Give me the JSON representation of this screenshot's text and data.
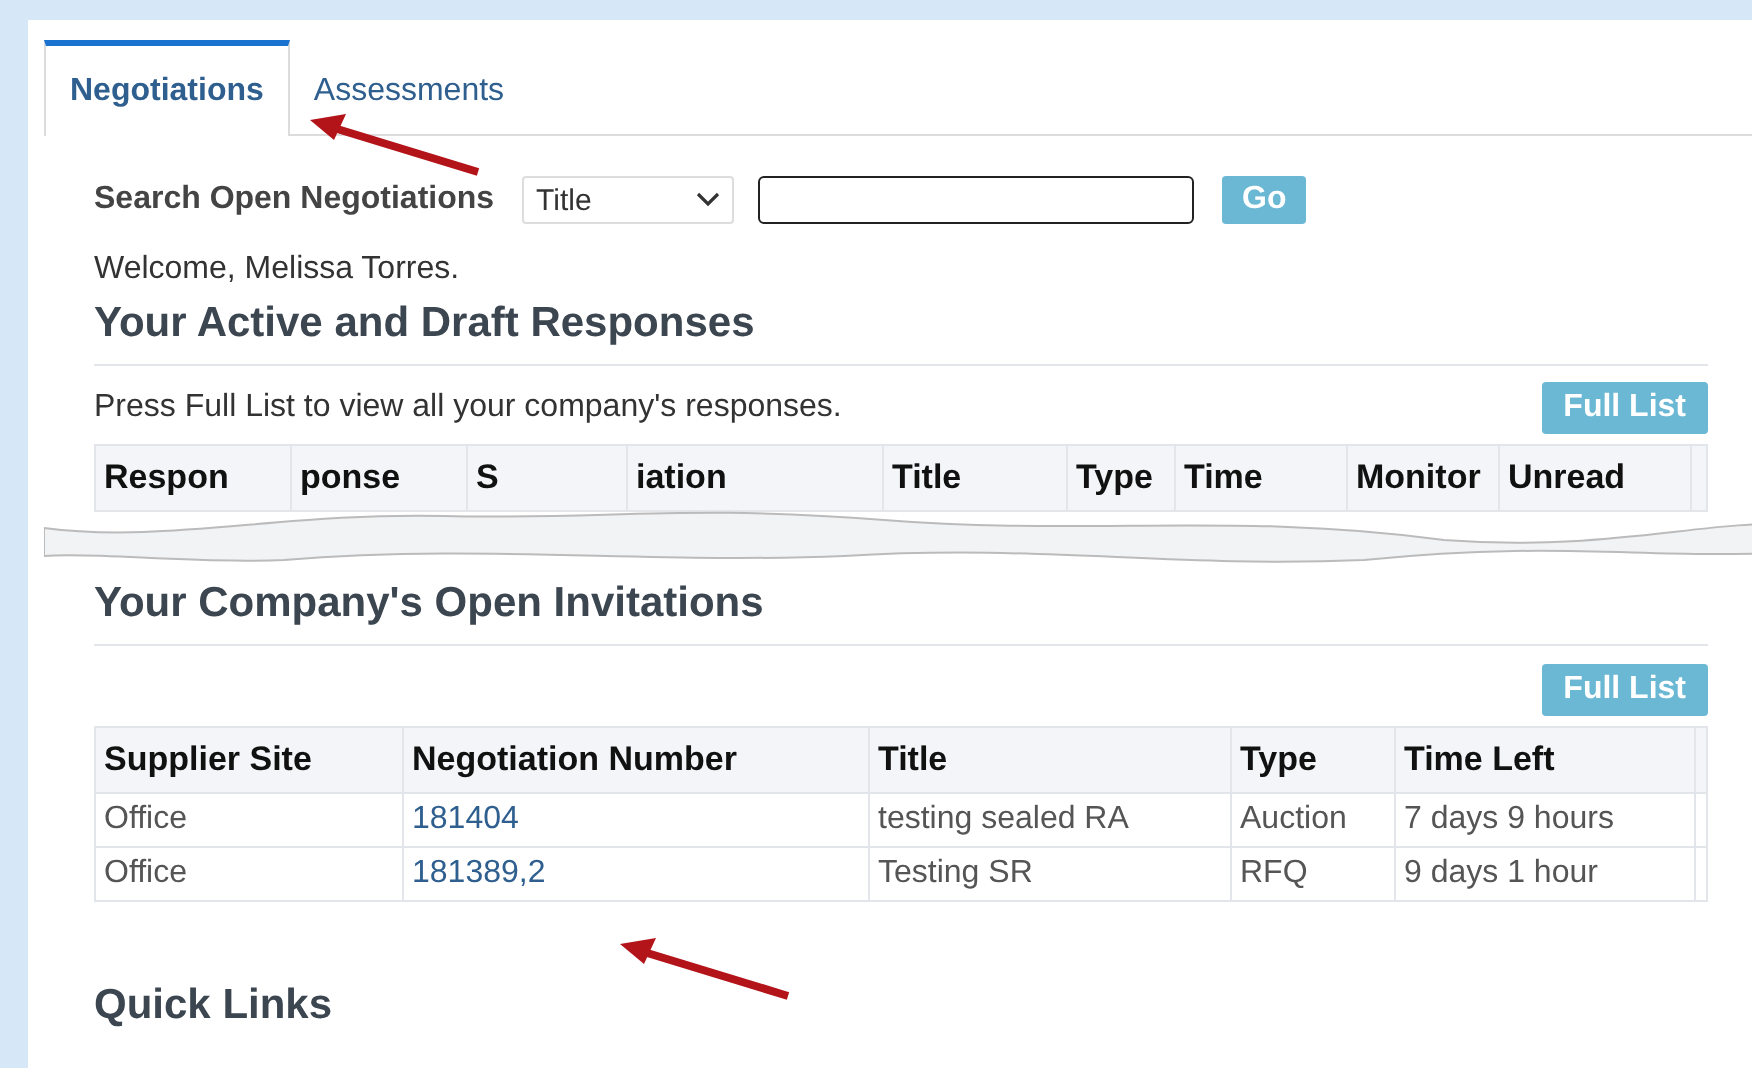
{
  "tabs": [
    {
      "label": "Negotiations",
      "selected": true
    },
    {
      "label": "Assessments",
      "selected": false
    }
  ],
  "search": {
    "label": "Search Open Negotiations",
    "select_value": "Title",
    "button": "Go"
  },
  "welcome": "Welcome, Melissa Torres.",
  "responses": {
    "heading": "Your Active and Draft Responses",
    "hint": "Press Full List to view all your company's responses.",
    "button": "Full List",
    "columns": [
      "Respon",
      "ponse",
      "S",
      "iation",
      "Title",
      "Type",
      "Time",
      "Monitor",
      "Unread"
    ]
  },
  "invitations": {
    "heading": "Your Company's Open Invitations",
    "button": "Full List",
    "columns": [
      "Supplier Site",
      "Negotiation Number",
      "Title",
      "Type",
      "Time Left"
    ],
    "rows": [
      [
        "Office",
        "181404",
        "testing sealed RA",
        "Auction",
        "7 days 9 hours"
      ],
      [
        "Office",
        "181389,2",
        "Testing SR",
        "RFQ",
        "9 days 1 hour"
      ]
    ]
  },
  "quick_links": {
    "heading": "Quick Links"
  }
}
